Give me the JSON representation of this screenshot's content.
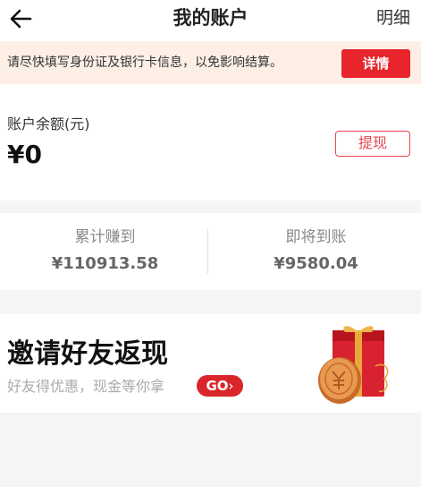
{
  "header": {
    "title": "我的账户",
    "detail_label": "明细",
    "back_icon": "arrow-left-icon"
  },
  "notice": {
    "text": "请尽快填写身份证及银行卡信息，以免影响结算。",
    "button_label": "详情"
  },
  "balance": {
    "label": "账户余额(元)",
    "value": "¥0",
    "withdraw_label": "提现"
  },
  "stats": {
    "earned_label": "累计赚到",
    "earned_value": "¥110913.58",
    "pending_label": "即将到账",
    "pending_value": "¥9580.04"
  },
  "banner": {
    "title": "邀请好友返现",
    "subtitle": "好友得优惠，现金等你拿",
    "go_label": "GO",
    "go_arrow": "›",
    "image_icon": "gift-box-coin-icon"
  },
  "colors": {
    "accent": "#e8252b",
    "notice_bg": "#fdeee6",
    "page_bg": "#f5f5f5"
  }
}
